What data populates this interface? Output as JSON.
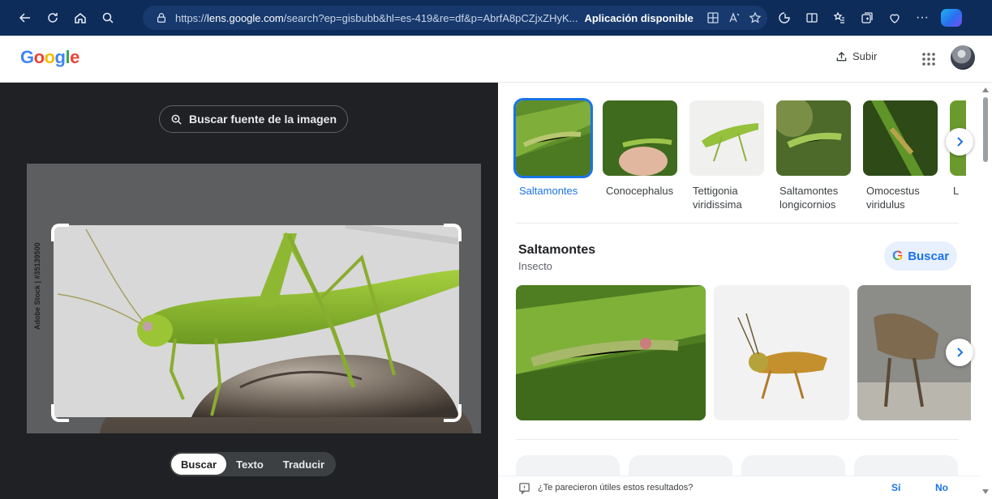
{
  "browser": {
    "url_prefix": "https://",
    "url_host": "lens.google.com",
    "url_rest": "/search?ep=gisbubb&hl=es-419&re=df&p=AbrfA8pCZjxZHyK...",
    "app_available": "Aplicación disponible",
    "more": "···"
  },
  "header": {
    "logo": [
      "G",
      "o",
      "o",
      "g",
      "l",
      "e"
    ],
    "upload_label": "Subir"
  },
  "lens": {
    "source_button": "Buscar fuente de la imagen",
    "watermark": "Adobe Stock | #35139500",
    "modes": [
      {
        "label": "Buscar",
        "active": true
      },
      {
        "label": "Texto",
        "active": false
      },
      {
        "label": "Traducir",
        "active": false
      }
    ]
  },
  "results": {
    "chips": [
      {
        "label": "Saltamontes",
        "selected": true
      },
      {
        "label": "Conocephalus",
        "selected": false
      },
      {
        "label": "Tettigonia viridissima",
        "selected": false
      },
      {
        "label": "Saltamontes longicornios",
        "selected": false
      },
      {
        "label": "Omocestus viridulus",
        "selected": false
      }
    ],
    "chip_overflow_label": "L",
    "entity_title": "Saltamontes",
    "entity_subtitle": "Insecto",
    "search_button": "Buscar",
    "search_button_glyph": "G",
    "feedback_question": "¿Te parecieron útiles estos resultados?",
    "feedback_yes": "Sí",
    "feedback_no": "No"
  },
  "colors": {
    "chrome_bg": "#0d2c5a",
    "accent": "#1a73e8",
    "lens_bg": "#202124"
  }
}
